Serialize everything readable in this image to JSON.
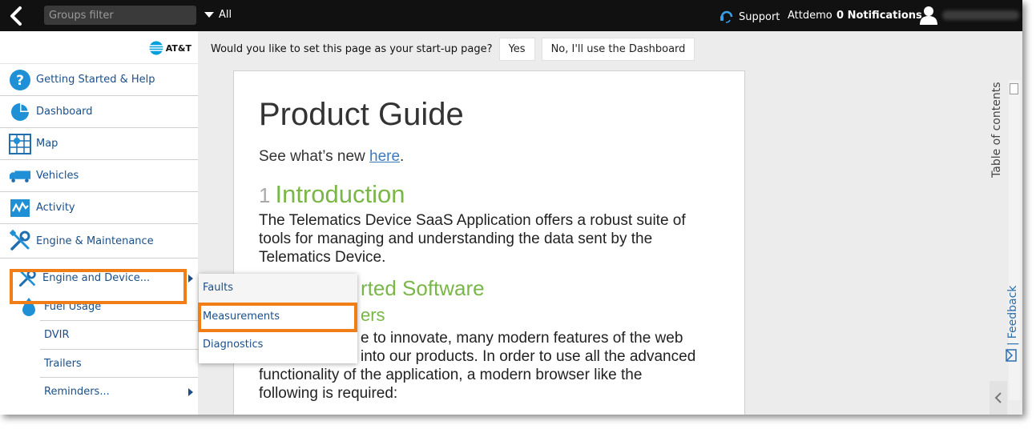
{
  "topbar": {
    "groups_filter_placeholder": "Groups filter",
    "all_label": "All",
    "support_label": "Support",
    "user_label": "Attdemo",
    "notifications_label": "0 Notifications"
  },
  "brand": {
    "logo_text": "AT&T"
  },
  "sidebar": {
    "items": [
      {
        "label": "Getting Started & Help",
        "icon": "help-icon"
      },
      {
        "label": "Dashboard",
        "icon": "pie-chart-icon"
      },
      {
        "label": "Map",
        "icon": "map-icon"
      },
      {
        "label": "Vehicles",
        "icon": "truck-icon"
      },
      {
        "label": "Activity",
        "icon": "activity-icon"
      },
      {
        "label": "Engine & Maintenance",
        "icon": "wrench-screwdriver-icon"
      }
    ],
    "sub_items": [
      {
        "label": "Engine and Device...",
        "icon": "wrench-screwdriver-icon",
        "has_submenu": true
      },
      {
        "label": "Fuel Usage",
        "icon": "fuel-drop-icon"
      },
      {
        "label": "DVIR"
      },
      {
        "label": "Trailers"
      },
      {
        "label": "Reminders...",
        "has_submenu": true
      }
    ]
  },
  "startup": {
    "question": "Would you like to set this page as your start-up page?",
    "yes_label": "Yes",
    "no_label": "No, I'll use the Dashboard"
  },
  "flyout": {
    "items": [
      "Faults",
      "Measurements",
      "Diagnostics"
    ]
  },
  "doc": {
    "title": "Product Guide",
    "whatsnew_prefix": "See what’s new ",
    "whatsnew_link": "here",
    "whatsnew_suffix": ".",
    "intro_number": "1",
    "intro_heading": "Introduction",
    "intro_line1": "The Telematics Device SaaS Application offers a robust suite of",
    "intro_line2": "tools for managing and understanding the data sent by the",
    "intro_line3": "Telematics Device.",
    "supported_heading": "rted Software",
    "browsers_heading": "ers",
    "body_line1": "e to innovate, many modern features of the web",
    "body_line2": "into our products. In order to use all the advanced",
    "body_line3": "functionality of the application, a modern browser like the",
    "body_line4": "following is required:"
  },
  "right": {
    "toc_label": "Table of contents",
    "feedback_label": "Feedback"
  },
  "colors": {
    "accent_orange": "#f07d16",
    "link_blue": "#1a4f8a",
    "heading_green": "#7ab648",
    "topbar": "#111111"
  }
}
